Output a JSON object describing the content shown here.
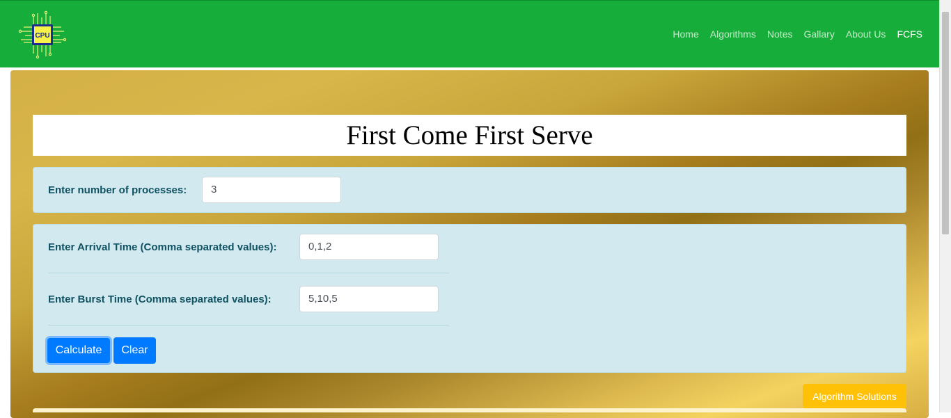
{
  "logo": {
    "text": "CPU"
  },
  "nav": {
    "items": [
      {
        "label": "Home",
        "active": false
      },
      {
        "label": "Algorithms",
        "active": false
      },
      {
        "label": "Notes",
        "active": false
      },
      {
        "label": "Gallary",
        "active": false
      },
      {
        "label": "About Us",
        "active": false
      },
      {
        "label": "FCFS",
        "active": true
      }
    ]
  },
  "page_title": "First Come First Serve",
  "processes": {
    "label": "Enter number of processes:",
    "value": "3"
  },
  "arrival": {
    "label": "Enter Arrival Time (Comma separated values):",
    "value": "0,1,2"
  },
  "burst": {
    "label": "Enter Burst Time (Comma separated values):",
    "value": "5,10,5"
  },
  "buttons": {
    "calculate": "Calculate",
    "clear": "Clear",
    "solutions": "Algorithm Solutions"
  },
  "colors": {
    "navbar": "#17ad3b",
    "primary": "#007bff",
    "warning": "#ffc107",
    "info_card": "#d1e9ef"
  }
}
